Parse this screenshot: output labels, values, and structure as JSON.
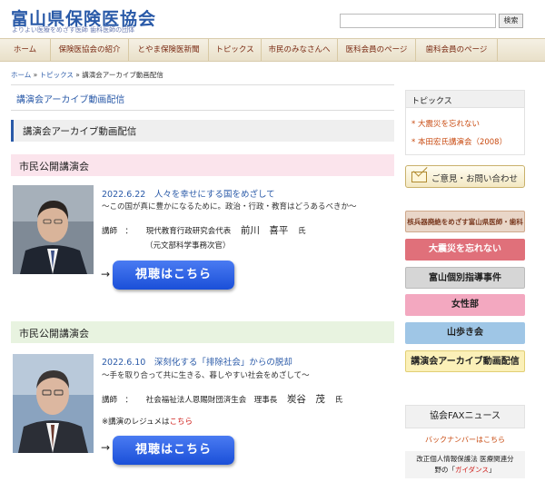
{
  "header": {
    "title": "富山県保険医協会",
    "subtitle": "よりよい医療をめざす医師 歯科医師の団体",
    "search_button": "検索",
    "search_placeholder": ""
  },
  "nav": {
    "items": [
      {
        "label": "ホーム"
      },
      {
        "label": "保険医協会の紹介"
      },
      {
        "label": "とやま保険医新聞"
      },
      {
        "label": "トピックス"
      },
      {
        "label": "市民のみなさんへ"
      },
      {
        "label": "医科会員のページ"
      },
      {
        "label": "歯科会員のページ"
      }
    ]
  },
  "breadcrumb": {
    "home": "ホーム",
    "sep1": " » ",
    "topics": "トピックス",
    "sep2": " » ",
    "current": "講演会アーカイブ動画配信"
  },
  "main": {
    "page_title": "講演会アーカイブ動画配信",
    "section_title": "講演会アーカイブ動画配信",
    "lectures": [
      {
        "band": "市民公開講演会",
        "title": "2022.6.22　人々を幸せにする国をめざして",
        "subtitle": "〜この国が真に豊かになるために。政治・行政・教育はどうあるべきか〜",
        "lecturer_label": "講師　：",
        "lecturer_org": "現代教育行政研究会代表",
        "lecturer_name": "前川　喜平",
        "lecturer_suffix": "氏",
        "lecturer_note": "（元文部科学事務次官）",
        "arrow": "→",
        "button": "視聴はこちら"
      },
      {
        "band": "市民公開講演会",
        "title": "2022.6.10　深刻化する「排除社会」からの脱却",
        "subtitle": "〜手を取り合って共に生きる、暮しやすい社会をめざして〜",
        "lecturer_label": "講師　：",
        "lecturer_org": "社会福祉法人恩賜財団済生会　理事長",
        "lecturer_name": "炭谷　茂",
        "lecturer_suffix": "氏",
        "resume_text": "※講演のレジュメは",
        "resume_link": "こちら",
        "arrow": "→",
        "button": "視聴はこちら"
      }
    ]
  },
  "sidebar": {
    "topics_heading": "トピックス",
    "topics": [
      {
        "label": "* 大震災を忘れない"
      },
      {
        "label": "* 本田宏氏講演会（2008）"
      }
    ],
    "contact": "ご意見・お問い合わせ",
    "banners": [
      {
        "label": "核兵器廃絶をめざす富山県医師・歯科医師の会",
        "bg": "#e9d6c8",
        "fg": "#7a3a20"
      },
      {
        "label": "大震災を忘れない",
        "bg": "#e0707a",
        "fg": "#ffffff"
      },
      {
        "label": "富山個別指導事件",
        "bg": "#d6d6d6",
        "fg": "#222222"
      },
      {
        "label": "女性部",
        "bg": "#f3a8c0",
        "fg": "#222222"
      },
      {
        "label": "山歩き会",
        "bg": "#9fc6e6",
        "fg": "#222222"
      },
      {
        "label": "講演会アーカイブ動画配信",
        "bg": "#fbf0b8",
        "fg": "#222222"
      }
    ],
    "fax_heading": "協会FAXニュース",
    "fax_link": "バックナンバーはこちら",
    "note_line1": "改正個人情報保護法 医療関連分",
    "note_line2_a": "野の「",
    "note_line2_b": "ガイダンス",
    "note_line2_c": "」"
  },
  "colors": {
    "brand_blue": "#2a5aa8",
    "nav_text": "#7a2b14",
    "link_orange": "#c84a10",
    "band_pink": "#fbe4ec",
    "band_green": "#e8f3e0",
    "button_blue": "#2a5ae6"
  }
}
